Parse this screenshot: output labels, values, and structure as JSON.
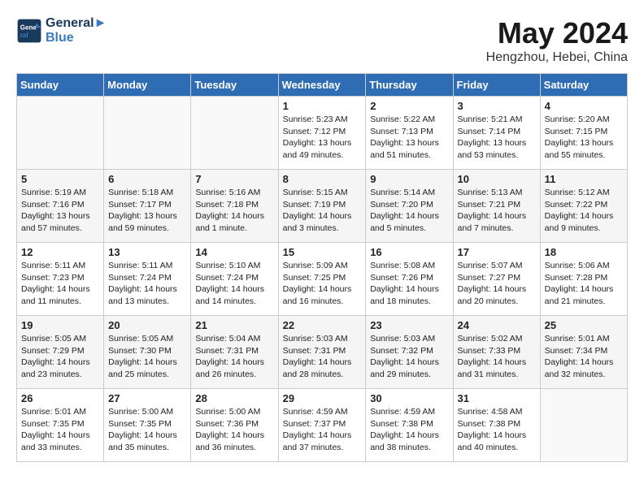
{
  "header": {
    "logo_line1": "General",
    "logo_line2": "Blue",
    "month": "May 2024",
    "location": "Hengzhou, Hebei, China"
  },
  "days_of_week": [
    "Sunday",
    "Monday",
    "Tuesday",
    "Wednesday",
    "Thursday",
    "Friday",
    "Saturday"
  ],
  "weeks": [
    [
      {
        "day": "",
        "info": ""
      },
      {
        "day": "",
        "info": ""
      },
      {
        "day": "",
        "info": ""
      },
      {
        "day": "1",
        "info": "Sunrise: 5:23 AM\nSunset: 7:12 PM\nDaylight: 13 hours\nand 49 minutes."
      },
      {
        "day": "2",
        "info": "Sunrise: 5:22 AM\nSunset: 7:13 PM\nDaylight: 13 hours\nand 51 minutes."
      },
      {
        "day": "3",
        "info": "Sunrise: 5:21 AM\nSunset: 7:14 PM\nDaylight: 13 hours\nand 53 minutes."
      },
      {
        "day": "4",
        "info": "Sunrise: 5:20 AM\nSunset: 7:15 PM\nDaylight: 13 hours\nand 55 minutes."
      }
    ],
    [
      {
        "day": "5",
        "info": "Sunrise: 5:19 AM\nSunset: 7:16 PM\nDaylight: 13 hours\nand 57 minutes."
      },
      {
        "day": "6",
        "info": "Sunrise: 5:18 AM\nSunset: 7:17 PM\nDaylight: 13 hours\nand 59 minutes."
      },
      {
        "day": "7",
        "info": "Sunrise: 5:16 AM\nSunset: 7:18 PM\nDaylight: 14 hours\nand 1 minute."
      },
      {
        "day": "8",
        "info": "Sunrise: 5:15 AM\nSunset: 7:19 PM\nDaylight: 14 hours\nand 3 minutes."
      },
      {
        "day": "9",
        "info": "Sunrise: 5:14 AM\nSunset: 7:20 PM\nDaylight: 14 hours\nand 5 minutes."
      },
      {
        "day": "10",
        "info": "Sunrise: 5:13 AM\nSunset: 7:21 PM\nDaylight: 14 hours\nand 7 minutes."
      },
      {
        "day": "11",
        "info": "Sunrise: 5:12 AM\nSunset: 7:22 PM\nDaylight: 14 hours\nand 9 minutes."
      }
    ],
    [
      {
        "day": "12",
        "info": "Sunrise: 5:11 AM\nSunset: 7:23 PM\nDaylight: 14 hours\nand 11 minutes."
      },
      {
        "day": "13",
        "info": "Sunrise: 5:11 AM\nSunset: 7:24 PM\nDaylight: 14 hours\nand 13 minutes."
      },
      {
        "day": "14",
        "info": "Sunrise: 5:10 AM\nSunset: 7:24 PM\nDaylight: 14 hours\nand 14 minutes."
      },
      {
        "day": "15",
        "info": "Sunrise: 5:09 AM\nSunset: 7:25 PM\nDaylight: 14 hours\nand 16 minutes."
      },
      {
        "day": "16",
        "info": "Sunrise: 5:08 AM\nSunset: 7:26 PM\nDaylight: 14 hours\nand 18 minutes."
      },
      {
        "day": "17",
        "info": "Sunrise: 5:07 AM\nSunset: 7:27 PM\nDaylight: 14 hours\nand 20 minutes."
      },
      {
        "day": "18",
        "info": "Sunrise: 5:06 AM\nSunset: 7:28 PM\nDaylight: 14 hours\nand 21 minutes."
      }
    ],
    [
      {
        "day": "19",
        "info": "Sunrise: 5:05 AM\nSunset: 7:29 PM\nDaylight: 14 hours\nand 23 minutes."
      },
      {
        "day": "20",
        "info": "Sunrise: 5:05 AM\nSunset: 7:30 PM\nDaylight: 14 hours\nand 25 minutes."
      },
      {
        "day": "21",
        "info": "Sunrise: 5:04 AM\nSunset: 7:31 PM\nDaylight: 14 hours\nand 26 minutes."
      },
      {
        "day": "22",
        "info": "Sunrise: 5:03 AM\nSunset: 7:31 PM\nDaylight: 14 hours\nand 28 minutes."
      },
      {
        "day": "23",
        "info": "Sunrise: 5:03 AM\nSunset: 7:32 PM\nDaylight: 14 hours\nand 29 minutes."
      },
      {
        "day": "24",
        "info": "Sunrise: 5:02 AM\nSunset: 7:33 PM\nDaylight: 14 hours\nand 31 minutes."
      },
      {
        "day": "25",
        "info": "Sunrise: 5:01 AM\nSunset: 7:34 PM\nDaylight: 14 hours\nand 32 minutes."
      }
    ],
    [
      {
        "day": "26",
        "info": "Sunrise: 5:01 AM\nSunset: 7:35 PM\nDaylight: 14 hours\nand 33 minutes."
      },
      {
        "day": "27",
        "info": "Sunrise: 5:00 AM\nSunset: 7:35 PM\nDaylight: 14 hours\nand 35 minutes."
      },
      {
        "day": "28",
        "info": "Sunrise: 5:00 AM\nSunset: 7:36 PM\nDaylight: 14 hours\nand 36 minutes."
      },
      {
        "day": "29",
        "info": "Sunrise: 4:59 AM\nSunset: 7:37 PM\nDaylight: 14 hours\nand 37 minutes."
      },
      {
        "day": "30",
        "info": "Sunrise: 4:59 AM\nSunset: 7:38 PM\nDaylight: 14 hours\nand 38 minutes."
      },
      {
        "day": "31",
        "info": "Sunrise: 4:58 AM\nSunset: 7:38 PM\nDaylight: 14 hours\nand 40 minutes."
      },
      {
        "day": "",
        "info": ""
      }
    ]
  ]
}
